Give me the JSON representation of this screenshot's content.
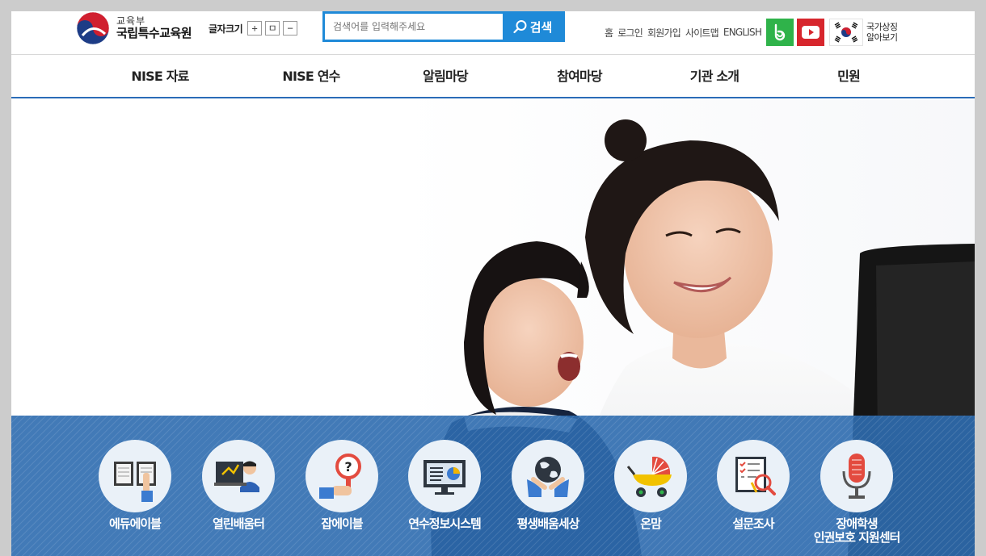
{
  "header": {
    "logo_sub": "교육부",
    "logo_main": "국립특수교육원",
    "font_size_label": "글자크기",
    "font_size_buttons": {
      "increase": "+",
      "reset": "ㅁ",
      "decrease": "−"
    },
    "search": {
      "placeholder": "검색어를 입력해주세요",
      "button_label": "검색"
    },
    "util_links": [
      "홈",
      "로그인",
      "회원가입",
      "사이트맵",
      "ENGLISH"
    ],
    "national_symbol": {
      "line1": "국가상징",
      "line2": "알아보기"
    }
  },
  "nav": {
    "items": [
      "NISE 자료",
      "NISE 연수",
      "알림마당",
      "참여마당",
      "기관 소개",
      "민원"
    ]
  },
  "quick_links": [
    {
      "label": "에듀에이블",
      "icon": "book-touch-icon"
    },
    {
      "label": "열린배움터",
      "icon": "teacher-board-icon"
    },
    {
      "label": "잡에이블",
      "icon": "question-magnifier-icon"
    },
    {
      "label": "연수정보시스템",
      "icon": "monitor-chart-icon"
    },
    {
      "label": "평생배움세상",
      "icon": "globe-hands-icon"
    },
    {
      "label": "온맘",
      "icon": "stroller-icon"
    },
    {
      "label": "설문조사",
      "icon": "checklist-search-icon"
    },
    {
      "label": "장애학생\n인권보호 지원센터",
      "icon": "microphone-icon"
    }
  ],
  "colors": {
    "accent": "#1f8ad8",
    "nav_border": "#2a6cb8",
    "quick_bg": "#2e6caf",
    "band": "#2fb34a",
    "youtube": "#d7262d"
  }
}
